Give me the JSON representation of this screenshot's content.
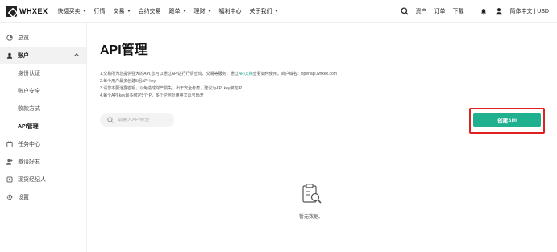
{
  "brand": {
    "logo_text": "WHXEX"
  },
  "nav": {
    "items": [
      {
        "label": "快捷买卖",
        "dropdown": true
      },
      {
        "label": "行情",
        "dropdown": false
      },
      {
        "label": "交易",
        "dropdown": true
      },
      {
        "label": "合约交易",
        "dropdown": false
      },
      {
        "label": "跟单",
        "dropdown": true
      },
      {
        "label": "理财",
        "dropdown": true
      },
      {
        "label": "福利中心",
        "dropdown": false
      },
      {
        "label": "关于我们",
        "dropdown": true
      }
    ],
    "right": {
      "assets": "资产",
      "orders": "订单",
      "download": "下载",
      "language_currency": "简体中文 | USD"
    }
  },
  "sidebar": {
    "overview": "总览",
    "account": "账户",
    "account_sub": [
      "身份认证",
      "账户安全",
      "收款方式",
      "API管理"
    ],
    "active_sub": "API管理",
    "tasks": "任务中心",
    "invite": "邀请好友",
    "broker": "现货经纪人",
    "settings": "设置"
  },
  "main": {
    "title": "API管理",
    "notes": {
      "line1_pre": "1.交易所为您提供强大的API,您可以通过API进行行情查询、交易等服务，通过",
      "line1_link": "API文档",
      "line1_post": "查看如何使用。商户域名：openapi.whxex.com",
      "line2": "2.每个用户最多创建5组API key",
      "line3": "3.请您不要泄露密钥，以免造成财产损失。出于安全考虑，建议为API key绑定IP",
      "line4": "4.每个API key最多绑定5个IP，多个IP地址用英文逗号隔开"
    },
    "search_placeholder": "请输入API标签",
    "create_button": "创建API",
    "empty_text": "暂无数据。"
  },
  "colors": {
    "accent": "#1fb08f",
    "highlight": "#e02020"
  }
}
